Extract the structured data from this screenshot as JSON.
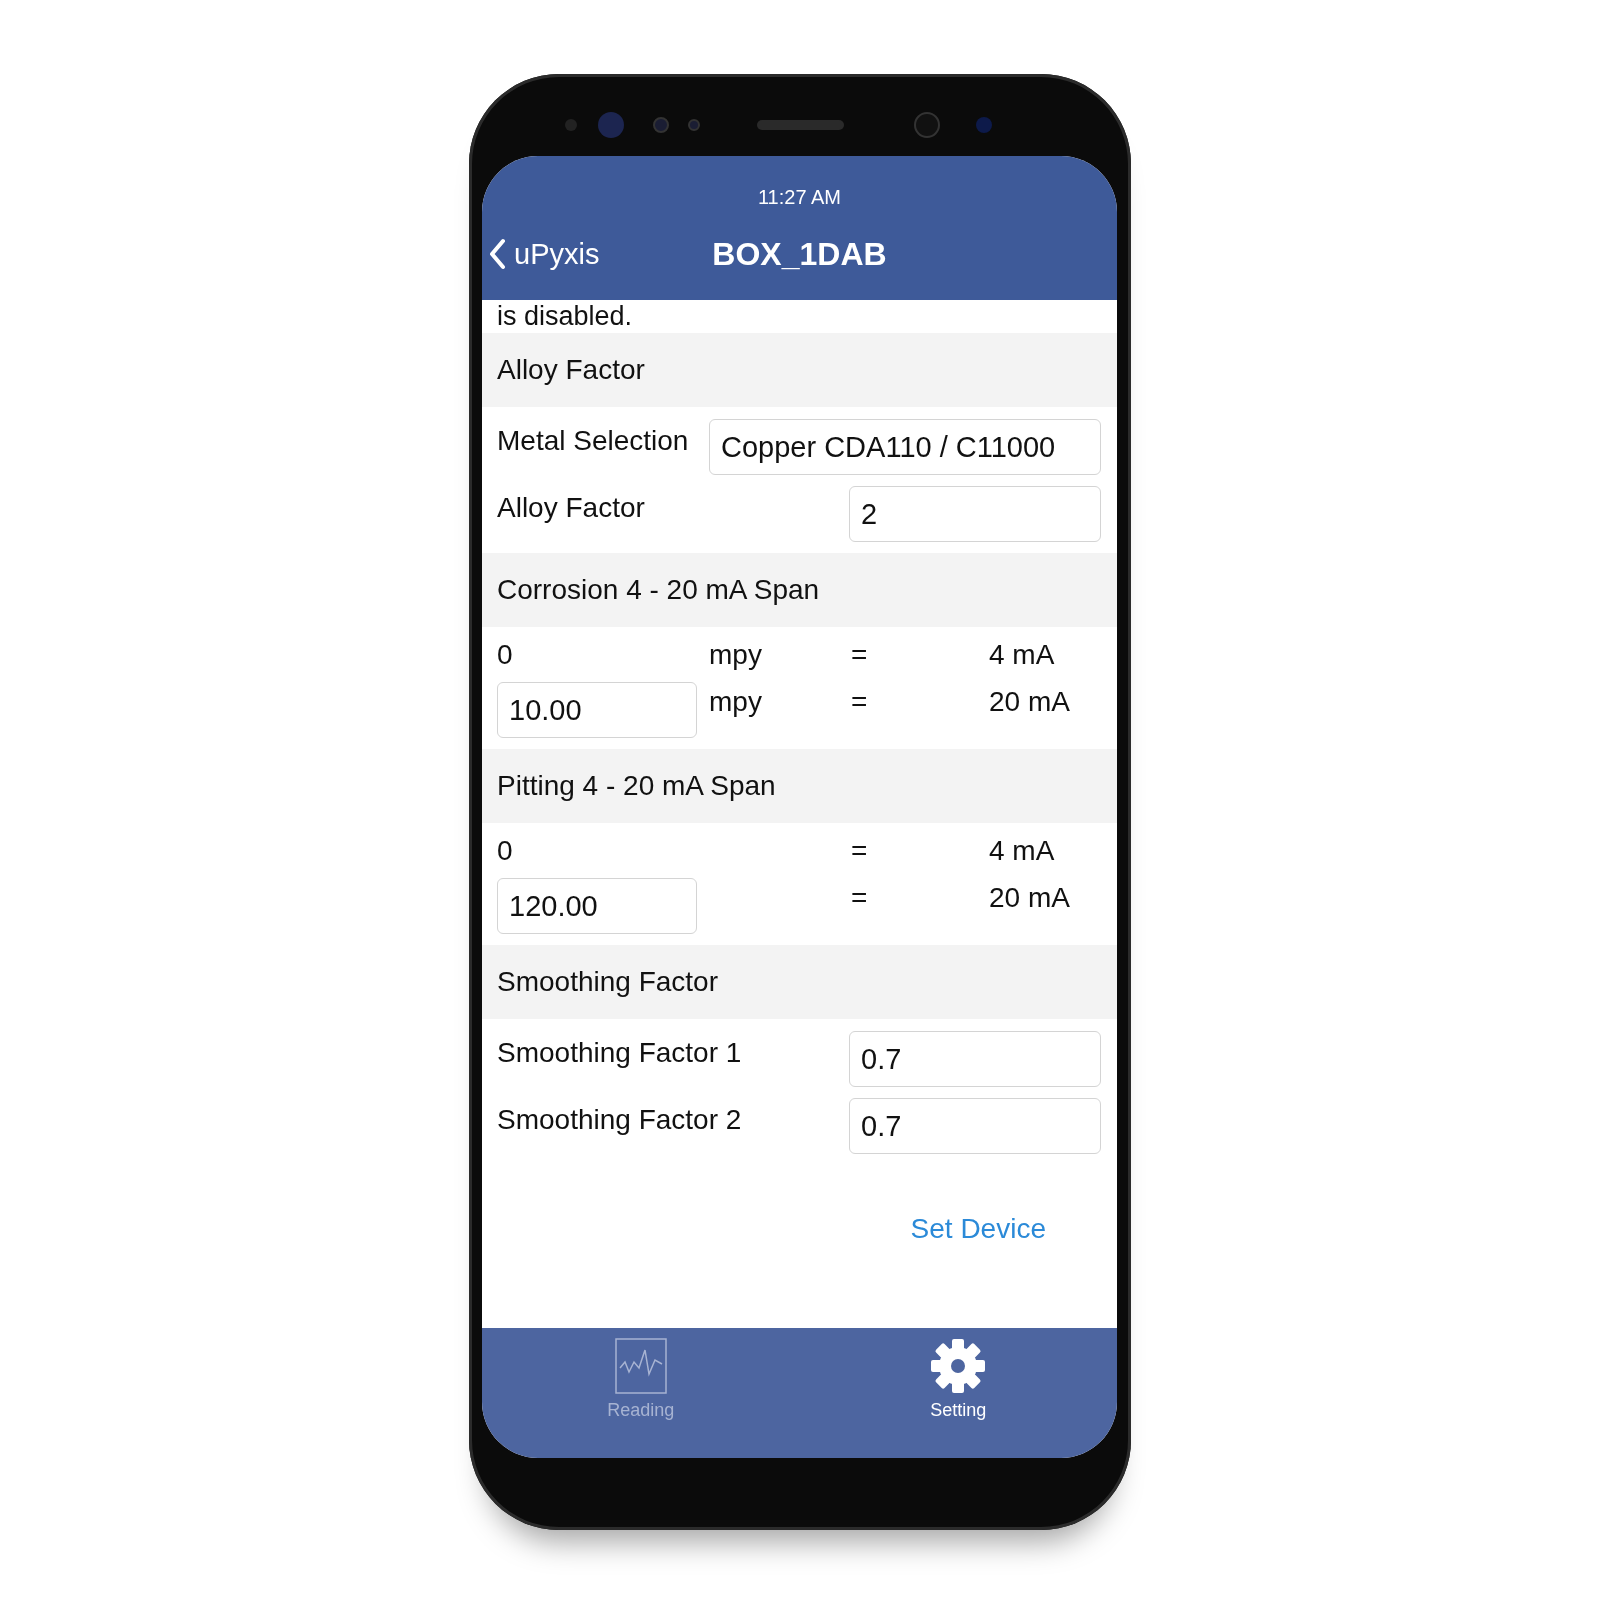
{
  "status_bar": {
    "time": "11:27 AM"
  },
  "nav_bar": {
    "back_label": "uPyxis",
    "title": "BOX_1DAB"
  },
  "cut_text": "is disabled.",
  "sections": [
    {
      "title": "Alloy Factor",
      "rows": [
        {
          "kind": "wide-field",
          "label": "Metal Selection",
          "value": "Copper CDA110 / C11000"
        },
        {
          "kind": "field",
          "label": "Alloy Factor",
          "value": "2"
        }
      ]
    },
    {
      "title": "Corrosion 4 - 20 mA Span",
      "rows": [
        {
          "kind": "span",
          "input": false,
          "value": "0",
          "unit": "mpy",
          "equals": "=",
          "output": "4 mA"
        },
        {
          "kind": "span",
          "input": true,
          "value": "10.00",
          "unit": "mpy",
          "equals": "=",
          "output": "20 mA"
        }
      ]
    },
    {
      "title": "Pitting 4 - 20 mA Span",
      "rows": [
        {
          "kind": "span",
          "input": false,
          "value": "0",
          "equals": "=",
          "output": "4 mA"
        },
        {
          "kind": "span",
          "input": true,
          "value": "120.00",
          "equals": "=",
          "output": "20 mA"
        }
      ]
    },
    {
      "title": "Smoothing Factor",
      "rows": [
        {
          "kind": "field",
          "label": "Smoothing Factor 1",
          "value": "0.7"
        },
        {
          "kind": "field",
          "label": "Smoothing Factor 2",
          "value": "0.7"
        }
      ]
    }
  ],
  "action_button": "Set Device",
  "tabs": [
    {
      "label": "Reading",
      "selected": false
    },
    {
      "label": "Setting",
      "selected": true
    }
  ]
}
